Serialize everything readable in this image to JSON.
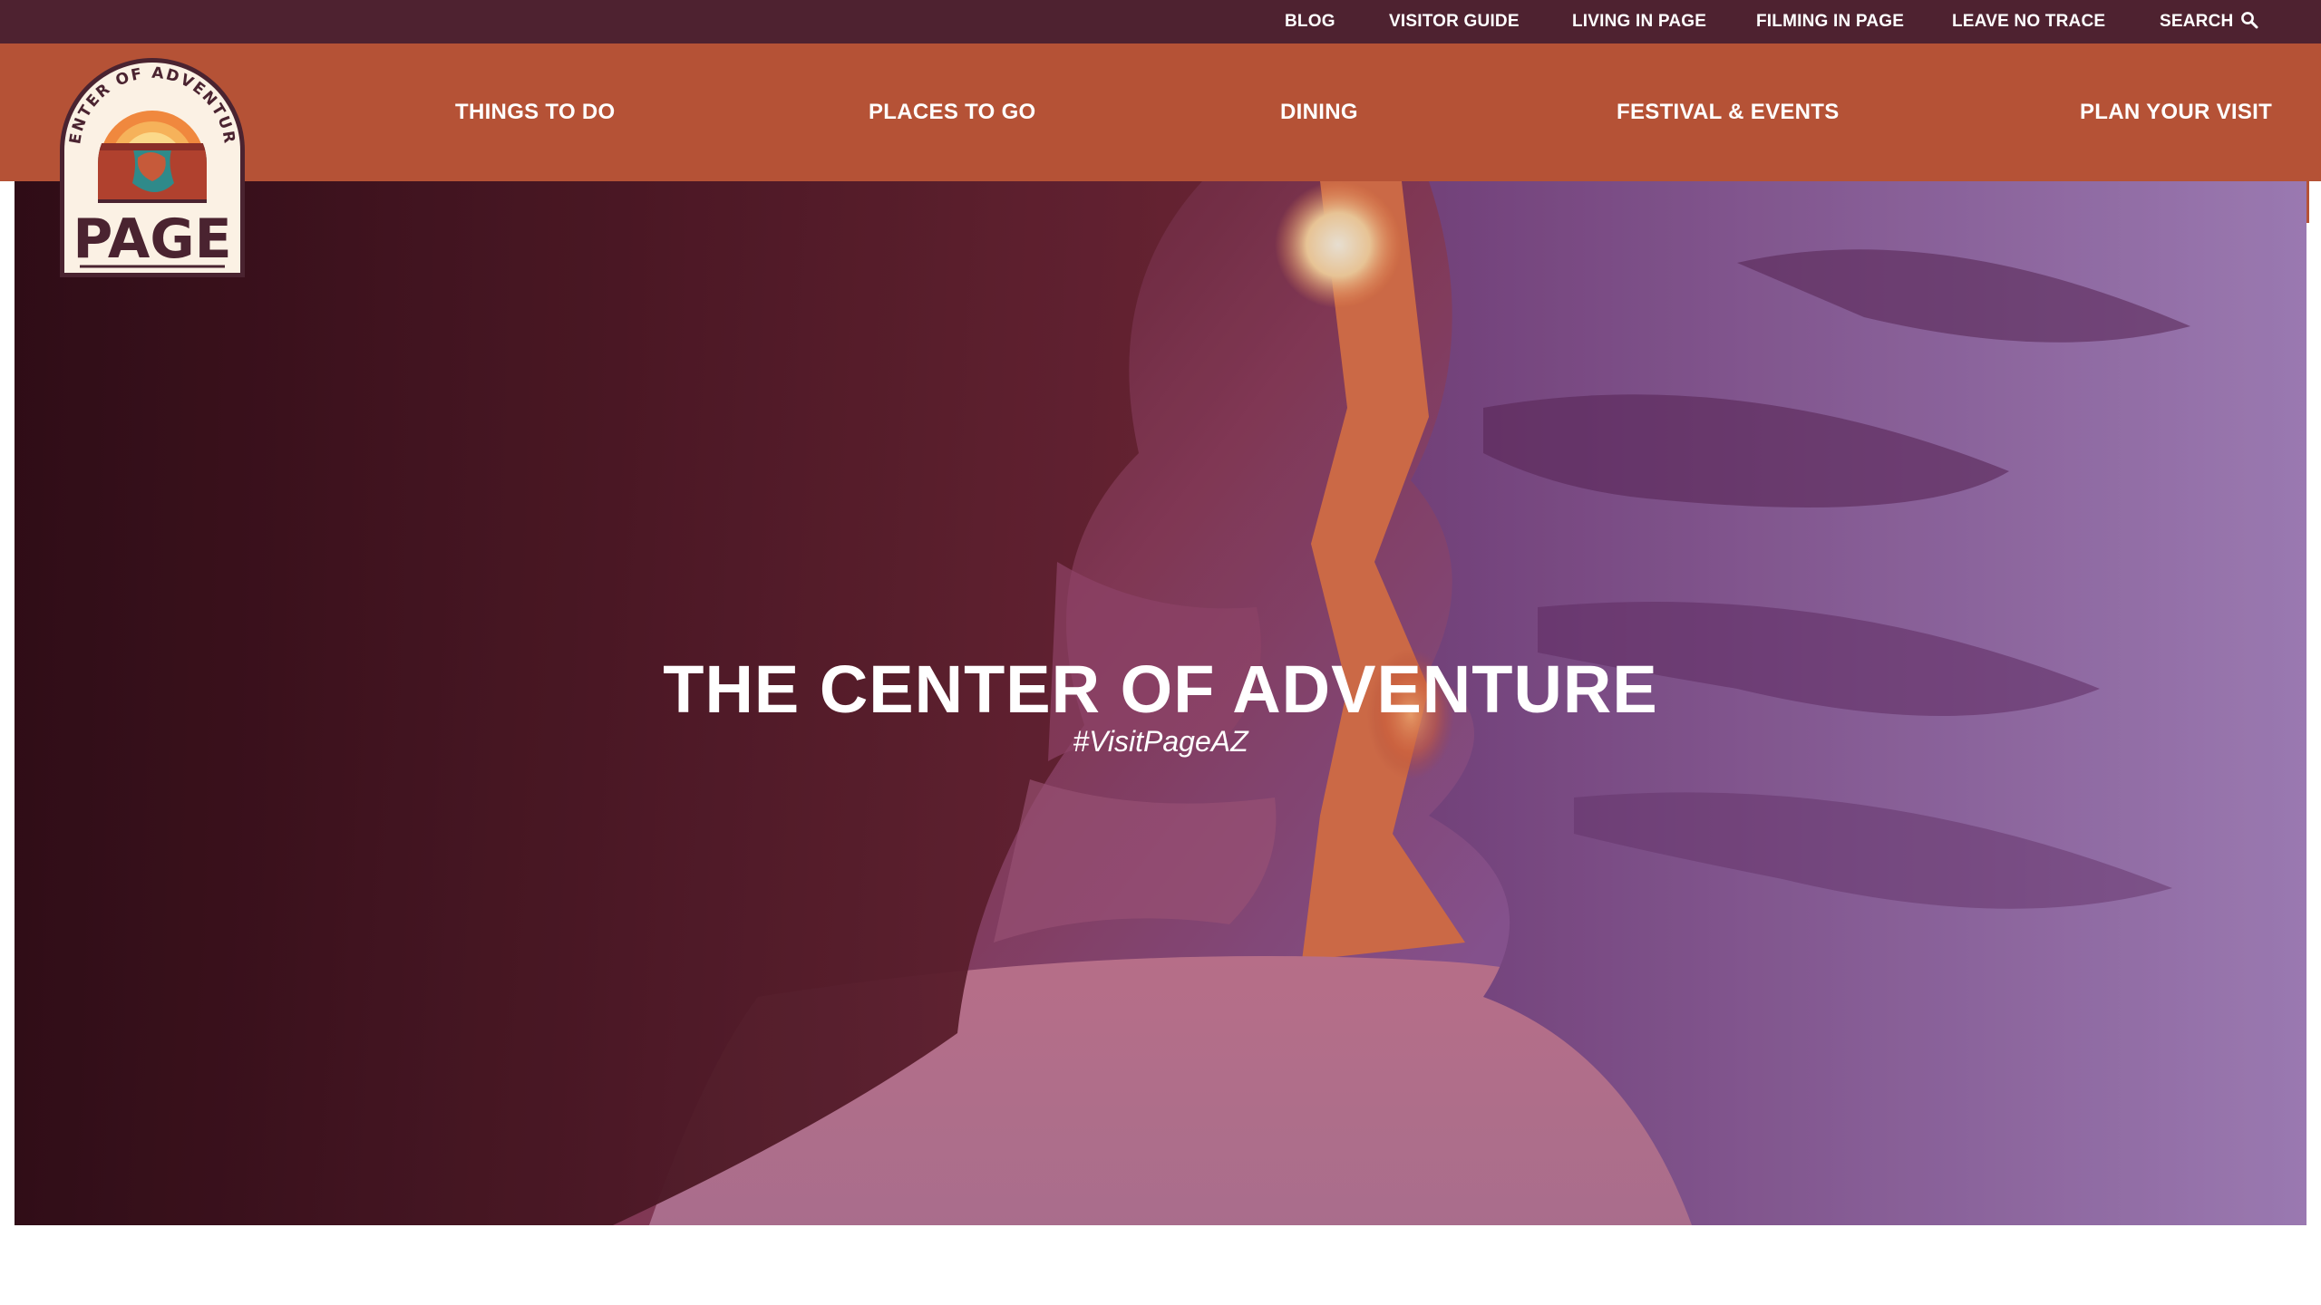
{
  "utility_nav": {
    "items": [
      {
        "label": "BLOG"
      },
      {
        "label": "VISITOR GUIDE"
      },
      {
        "label": "LIVING IN PAGE"
      },
      {
        "label": "FILMING IN PAGE"
      },
      {
        "label": "LEAVE NO TRACE"
      },
      {
        "label": "SEARCH",
        "icon": "search-icon"
      }
    ]
  },
  "main_nav": {
    "items": [
      {
        "label": "THINGS TO DO"
      },
      {
        "label": "PLACES TO GO"
      },
      {
        "label": "DINING"
      },
      {
        "label": "FESTIVAL & EVENTS"
      },
      {
        "label": "PLAN YOUR VISIT"
      }
    ]
  },
  "logo": {
    "arc_text": "CENTER OF ADVENTURE",
    "wordmark": "PAGE"
  },
  "hero": {
    "headline": "THE CENTER OF ADVENTURE",
    "hashtag": "#VisitPageAZ"
  },
  "colors": {
    "utility_bar": "#4e2230",
    "main_nav": "#b55236",
    "logo_cream": "#fbf1e4",
    "logo_teal": "#2f8a8a",
    "logo_dark": "#4a2330"
  }
}
